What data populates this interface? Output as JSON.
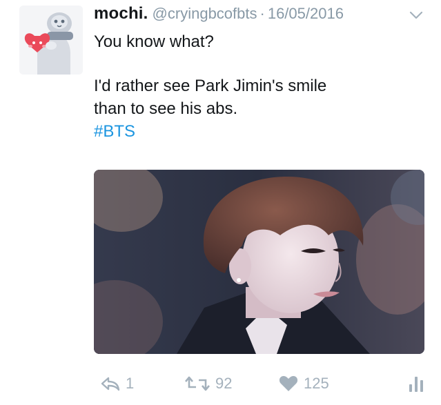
{
  "tweet": {
    "display_name": "mochi.",
    "handle": "@cryingbcofbts",
    "separator": "·",
    "date": "16/05/2016",
    "text_line1": "You know what?",
    "text_line2": "I'd rather see Park Jimin's smile",
    "text_line3": "than to see his abs.",
    "hashtag": "#BTS"
  },
  "actions": {
    "reply_count": "1",
    "retweet_count": "92",
    "like_count": "125"
  },
  "icons": {
    "caret": "chevron-down-icon",
    "reply": "reply-icon",
    "retweet": "retweet-icon",
    "like": "heart-icon",
    "stats": "analytics-icon"
  },
  "colors": {
    "hashtag": "#1b95e0",
    "muted": "#8899a6",
    "action": "#a4b1bc"
  }
}
